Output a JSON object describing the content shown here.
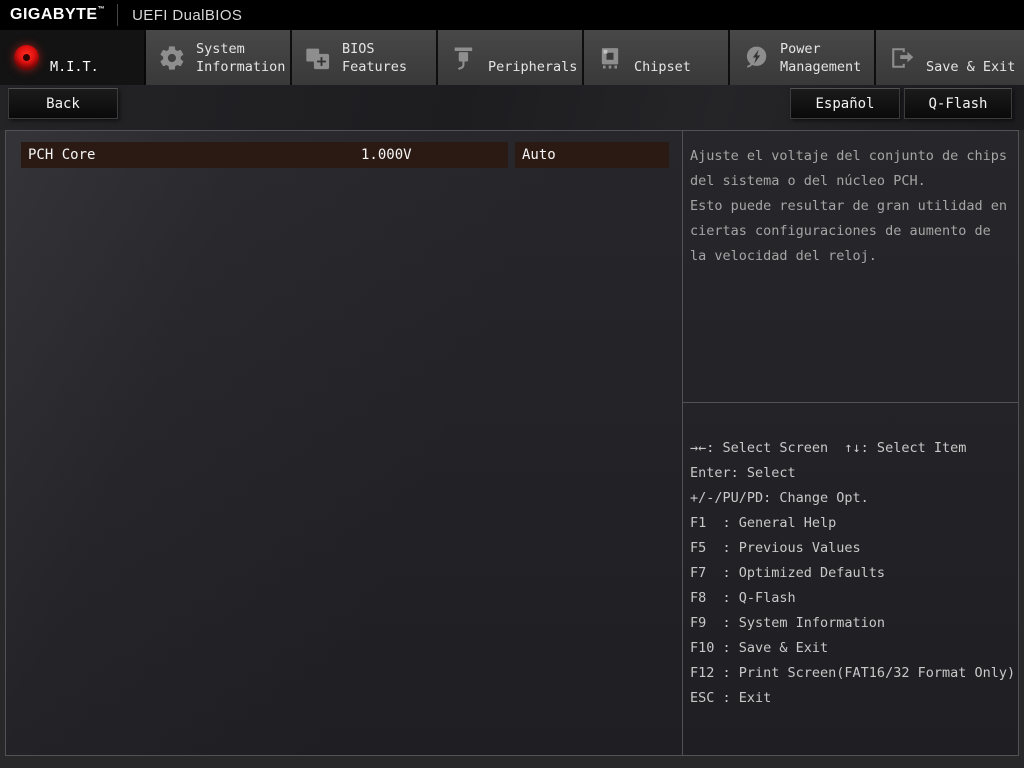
{
  "header": {
    "brand": "GIGABYTE",
    "brand_tm": "™",
    "title": "UEFI DualBIOS"
  },
  "tabs": [
    {
      "label": "M.I.T.",
      "icon": "red-record-icon",
      "active": true
    },
    {
      "label": "System\nInformation",
      "icon": "gear-icon",
      "active": false
    },
    {
      "label": "BIOS\nFeatures",
      "icon": "chip-plus-icon",
      "active": false
    },
    {
      "label": "Peripherals",
      "icon": "peripheral-icon",
      "active": false
    },
    {
      "label": "Chipset",
      "icon": "chipset-icon",
      "active": false
    },
    {
      "label": "Power\nManagement",
      "icon": "power-bolt-icon",
      "active": false
    },
    {
      "label": "Save & Exit",
      "icon": "save-exit-icon",
      "active": false
    }
  ],
  "toolbar": {
    "back_label": "Back",
    "language_label": "Español",
    "qflash_label": "Q-Flash"
  },
  "settings": [
    {
      "name": "PCH Core",
      "value": "1.000V",
      "option": "Auto"
    }
  ],
  "help": {
    "text": "Ajuste el voltaje del conjunto de chips\ndel sistema o del núcleo PCH.\nEsto puede resultar de gran utilidad en\nciertas configuraciones de aumento de\nla velocidad del reloj."
  },
  "shortcuts": [
    "→←: Select Screen  ↑↓: Select Item",
    "Enter: Select",
    "+/-/PU/PD: Change Opt.",
    "F1  : General Help",
    "F5  : Previous Values",
    "F7  : Optimized Defaults",
    "F8  : Q-Flash",
    "F9  : System Information",
    "F10 : Save & Exit",
    "F12 : Print Screen(FAT16/32 Format Only)",
    "ESC : Exit"
  ],
  "colors": {
    "accent_red": "#e31010",
    "row_highlight": "#2b1a14",
    "tab_gray": "#414141",
    "topbar": "#000000"
  }
}
